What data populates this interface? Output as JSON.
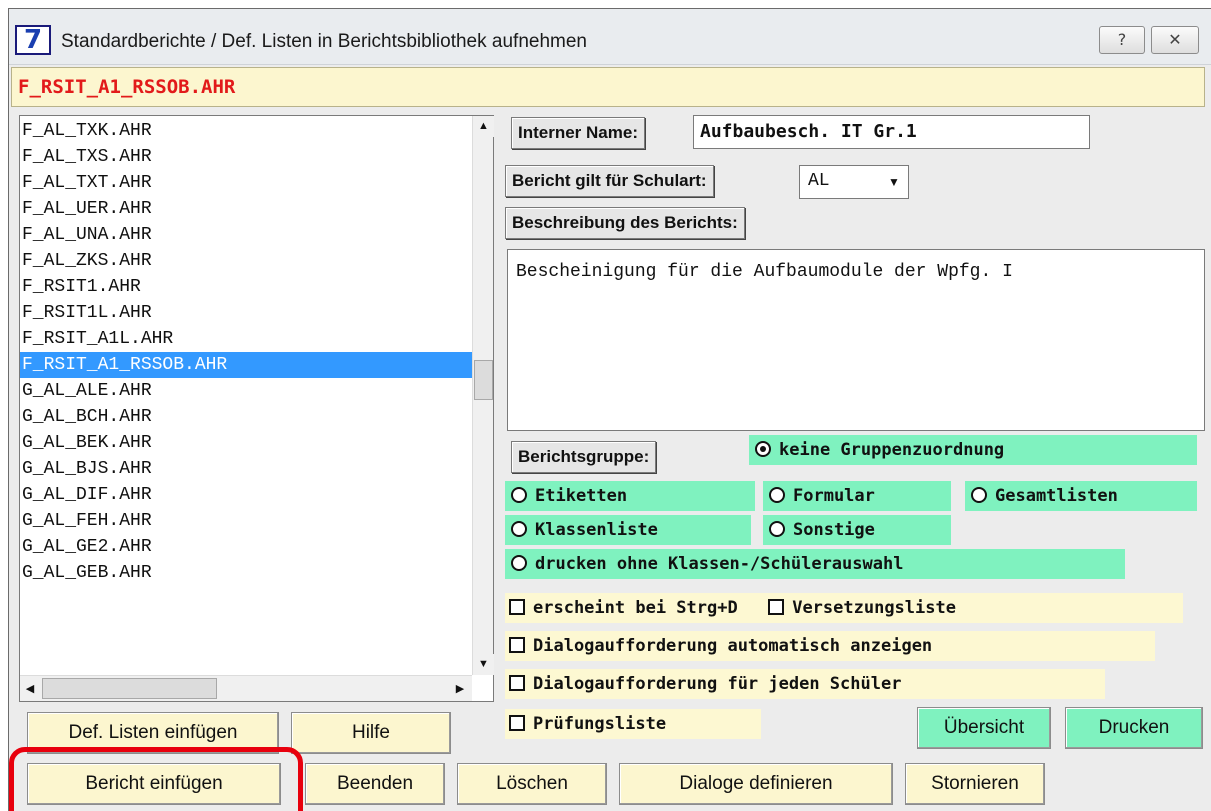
{
  "window": {
    "title": "Standardberichte / Def. Listen in Berichtsbibliothek aufnehmen",
    "app_icon_label": "7",
    "help_button_label": "?",
    "close_button_label": "✕"
  },
  "current_file": "F_RSIT_A1_RSSOB.AHR",
  "file_list": {
    "items": [
      "F_AL_TXK.AHR",
      "F_AL_TXS.AHR",
      "F_AL_TXT.AHR",
      "F_AL_UER.AHR",
      "F_AL_UNA.AHR",
      "F_AL_ZKS.AHR",
      "F_RSIT1.AHR",
      "F_RSIT1L.AHR",
      "F_RSIT_A1L.AHR",
      "F_RSIT_A1_RSSOB.AHR",
      "G_AL_ALE.AHR",
      "G_AL_BCH.AHR",
      "G_AL_BEK.AHR",
      "G_AL_BJS.AHR",
      "G_AL_DIF.AHR",
      "G_AL_FEH.AHR",
      "G_AL_GE2.AHR",
      "G_AL_GEB.AHR"
    ],
    "selected_index": 9
  },
  "form": {
    "internal_name_label": "Interner Name:",
    "internal_name_value": "Aufbaubesch. IT Gr.1",
    "school_type_label": "Bericht gilt für Schulart:",
    "school_type_value": "AL",
    "description_label": "Beschreibung des Berichts:",
    "description_value": "Bescheinigung für die Aufbaumodule der Wpfg. I",
    "group_label": "Berichtsgruppe:"
  },
  "report_groups": {
    "selected": "keine Gruppenzuordnung",
    "options": {
      "none": "keine Gruppenzuordnung",
      "labels": "Etiketten",
      "form": "Formular",
      "totals": "Gesamtlisten",
      "classlist": "Klassenliste",
      "other": "Sonstige",
      "no_selection": "drucken ohne Klassen-/Schülerauswahl"
    }
  },
  "checkboxes": {
    "ctrl_d": "erscheint bei Strg+D",
    "promotion": "Versetzungsliste",
    "dialog_auto": "Dialogaufforderung automatisch anzeigen",
    "dialog_each": "Dialogaufforderung für jeden Schüler",
    "exam": "Prüfungsliste"
  },
  "buttons": {
    "def_lists": "Def. Listen einfügen",
    "help": "Hilfe",
    "overview": "Übersicht",
    "print": "Drucken",
    "insert_report": "Bericht einfügen",
    "exit": "Beenden",
    "delete": "Löschen",
    "define_dialogs": "Dialoge definieren",
    "cancel": "Stornieren"
  },
  "colors": {
    "accent_yellow": "#fcf6cf",
    "option_green": "#7ff2bf",
    "selection_blue": "#3399ff",
    "filename_red": "#e21a1a",
    "highlight_red": "#e8000d"
  }
}
